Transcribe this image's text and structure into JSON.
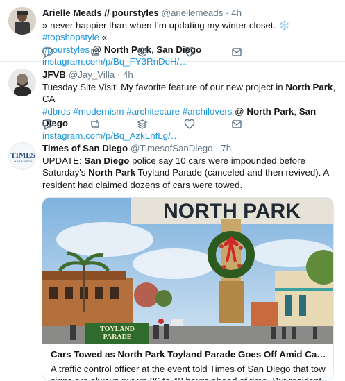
{
  "tweets": [
    {
      "name": "Arielle Meads // pourstyles",
      "handle": "@ariellemeads",
      "time": "4h",
      "line1_a": "» never happier than when I’m updating my winter closet. ",
      "snowflake": "❄️",
      "line1_b": " ",
      "hashtag1": "#topshopstyle",
      "line1_c": " «",
      "hashtag2": "#pourstyles",
      "at": " @ ",
      "loc1": "North Park",
      "comma": ", ",
      "loc2": "San Diego",
      "url": "instagram.com/p/Bq_FY3RnDoH/…"
    },
    {
      "name": "JFVB",
      "handle": "@Jay_Villa",
      "time": "4h",
      "line1_a": "Tuesday Site Visit! My favorite feature of our new project in ",
      "loc1": "North Park",
      "line1_b": ", CA",
      "hashtags": "#dbrds #modernism #architecture #archilovers",
      "at": " @ ",
      "loc2a": "North Park",
      "comma": ", ",
      "loc2b": "San Diego",
      "url": "instagram.com/p/Bq_AzkLnfLg/…"
    },
    {
      "name": "Times of San Diego",
      "handle": "@TimesofSanDiego",
      "time": "7h",
      "text_a": "UPDATE: ",
      "b1": "San Diego",
      "text_b": " police say 10 cars were impounded before Saturday's ",
      "b2": "North Park",
      "text_c": " Toyland Parade (canceled and then revived). A resident had claimed dozens of cars were towed.",
      "avatar_text1": "TIMES",
      "avatar_text2": "of SAN DIEGO",
      "sign_text": "NORTH PARK",
      "banner_text1": "TOYLAND",
      "banner_text2": "PARADE",
      "card_title": "Cars Towed as North Park Toyland Parade Goes Off Amid Cancellatio…",
      "card_desc": "A traffic control officer at the event told Times of San Diego that tow signs are always put up 36 to 48 hours ahead of time. But resident Kelly Murphy …"
    }
  ],
  "icons": [
    "reply-icon",
    "retweet-icon",
    "stack-icon",
    "like-icon",
    "message-icon"
  ],
  "colors": {
    "link": "#1b95e0",
    "meta": "#657786",
    "icon": "#657786"
  }
}
